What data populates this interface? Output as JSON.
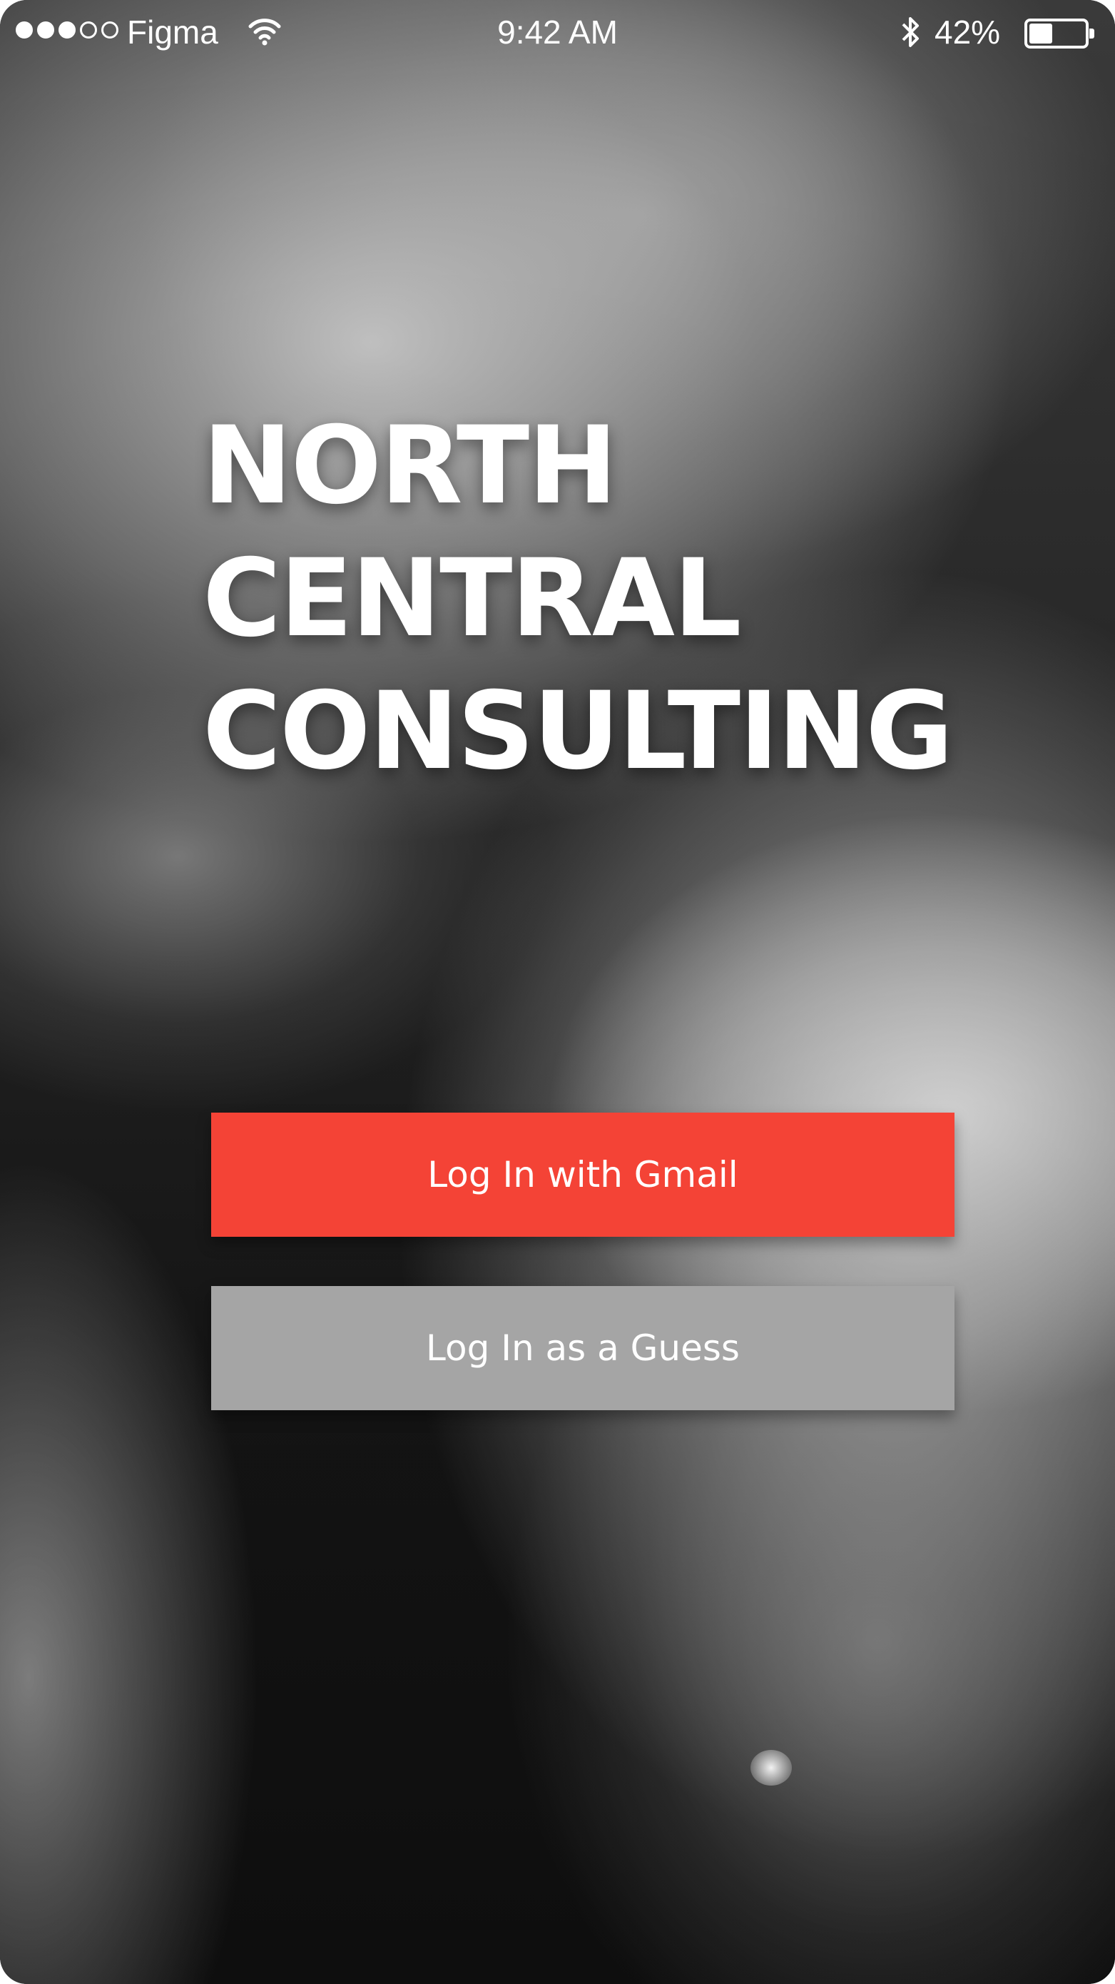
{
  "status_bar": {
    "signal_dots": [
      true,
      true,
      true,
      false,
      false
    ],
    "carrier": "Figma",
    "time": "9:42 AM",
    "battery_percent_label": "42%",
    "battery_level": 0.42,
    "icons": [
      "wifi-icon",
      "bluetooth-icon",
      "battery-icon"
    ]
  },
  "brand": {
    "title_lines": [
      "NORTH",
      "CENTRAL",
      "CONSULTING"
    ]
  },
  "actions": {
    "gmail_label": "Log In with Gmail",
    "guest_label": "Log In as a Guess"
  },
  "colors": {
    "gmail_button": "#F44336",
    "guest_button": "#A5A5A5",
    "text": "#FFFFFF"
  }
}
